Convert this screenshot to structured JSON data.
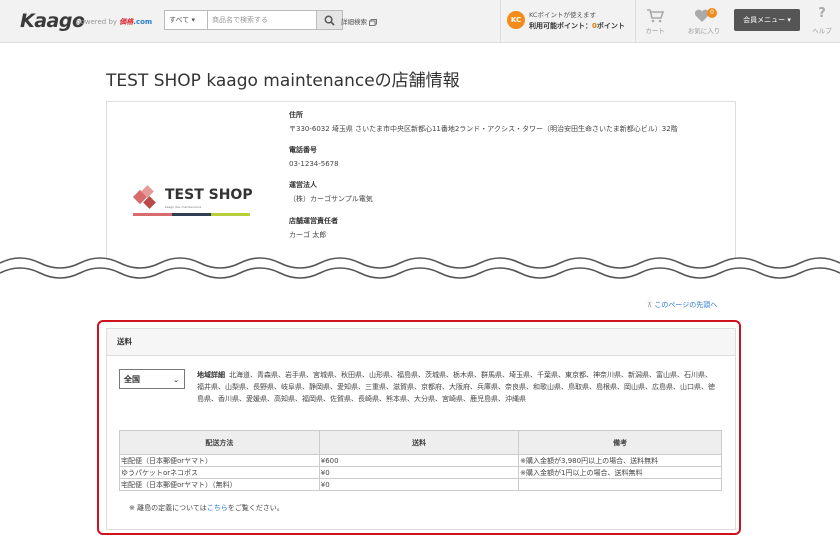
{
  "header": {
    "logo": "Kaago",
    "powered_by": "powered by",
    "powered_brand": "価格",
    "powered_com": ".com",
    "search_category": "すべて ▾",
    "search_placeholder": "商品名で検索する",
    "advanced_search": "詳細検索",
    "kc_badge": "KC",
    "kc_line1": "KCポイントが使えます",
    "kc_line2_prefix": "利用可能ポイント：",
    "kc_points": "0",
    "kc_line2_suffix": "ポイント",
    "cart_label": "カート",
    "favorites_label": "お気に入り",
    "favorites_count": "0",
    "member_menu": "会員メニュー ▾",
    "help_label": "ヘルプ",
    "help_glyph": "?"
  },
  "page": {
    "title": "TEST SHOP kaago maintenanceの店舗情報"
  },
  "shop": {
    "logo_text": "TEST SHOP",
    "logo_sub": "kaago dev maintenance",
    "address_label": "住所",
    "address_value": "〒330-6032 埼玉県 さいたま市中央区新都心11番地2ランド・アクシス・タワー（明治安田生命さいたま新都心ビル）32階",
    "phone_label": "電話番号",
    "phone_value": "03-1234-5678",
    "company_label": "運営法人",
    "company_value": "（株）カーゴサンプル電気",
    "manager_label": "店舗運営責任者",
    "manager_value": "カーゴ 太郎"
  },
  "page_top_link": "このページの先頭へ",
  "shipping": {
    "heading": "送料",
    "region_selected": "全国",
    "region_detail_label": "地域詳細",
    "region_detail_text": "北海道、青森県、岩手県、宮城県、秋田県、山形県、福島県、茨城県、栃木県、群馬県、埼玉県、千葉県、東京都、神奈川県、新潟県、富山県、石川県、福井県、山梨県、長野県、岐阜県、静岡県、愛知県、三重県、滋賀県、京都府、大阪府、兵庫県、奈良県、和歌山県、鳥取県、島根県、岡山県、広島県、山口県、徳島県、香川県、愛媛県、高知県、福岡県、佐賀県、長崎県、熊本県、大分県、宮崎県、鹿児島県、沖縄県",
    "columns": [
      "配送方法",
      "送料",
      "備考"
    ],
    "rows": [
      {
        "method": "宅配便（日本郵便orヤマト）",
        "fee": "¥600",
        "note": "※購入金額が3,980円以上の場合、送料無料"
      },
      {
        "method": "ゆうパケットorネコポス",
        "fee": "¥0",
        "note": "※購入金額が1円以上の場合、送料無料"
      },
      {
        "method": "宅配便（日本郵便orヤマト）（無料）",
        "fee": "¥0",
        "note": ""
      }
    ],
    "note_prefix": "※ 離島の定義については",
    "note_link": "こちら",
    "note_suffix": "をご覧ください。"
  },
  "colors": {
    "frame_red": "#d0121b",
    "link_blue": "#2a7ccf",
    "kc_orange": "#f28c1a"
  }
}
